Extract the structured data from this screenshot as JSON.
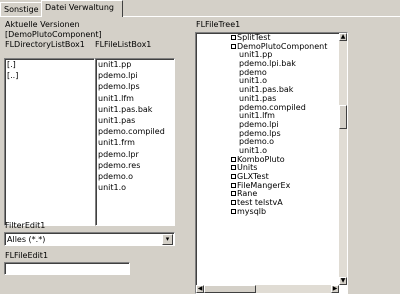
{
  "tabs": [
    "Sonstige",
    "Datei Verwaltung"
  ],
  "labels": {
    "versions": "Aktuelle Versionen",
    "component": "[DemoPlutoComponent]",
    "dir_header": "FLDirectoryListBox1",
    "file_header": "FLFileListBox1",
    "filter": "FilterEdit1",
    "file_edit": "FLFileEdit1",
    "tree": "FLFileTree1"
  },
  "dir_list": [
    "[.]",
    "[..]"
  ],
  "file_list": [
    "unit1.pp",
    "pdemo.lpi",
    "pdemo.lps",
    "unit1.lfm",
    "unit1.pas.bak",
    "unit1.pas",
    "pdemo.compiled",
    "unit1.frm",
    "pdemo.lpr",
    "pdemo.res",
    "pdemo.o",
    "unit1.o"
  ],
  "filter": {
    "value": "Alles (*.*)"
  },
  "file_edit": {
    "value": ""
  },
  "tree": [
    {
      "label": "SplitTest",
      "indent": 1,
      "box": true
    },
    {
      "label": "DemoPlutoComponent",
      "indent": 1,
      "box": true
    },
    {
      "label": "unit1.pp",
      "indent": 2,
      "box": false
    },
    {
      "label": "pdemo.lpi.bak",
      "indent": 2,
      "box": false
    },
    {
      "label": "pdemo",
      "indent": 2,
      "box": false
    },
    {
      "label": "unit1.o",
      "indent": 2,
      "box": false
    },
    {
      "label": "unit1.pas.bak",
      "indent": 2,
      "box": false
    },
    {
      "label": "unit1.pas",
      "indent": 2,
      "box": false
    },
    {
      "label": "pdemo.compiled",
      "indent": 2,
      "box": false
    },
    {
      "label": "unit1.lfm",
      "indent": 2,
      "box": false
    },
    {
      "label": "pdemo.lpi",
      "indent": 2,
      "box": false
    },
    {
      "label": "pdemo.lps",
      "indent": 2,
      "box": false
    },
    {
      "label": "pdemo.o",
      "indent": 2,
      "box": false
    },
    {
      "label": "unit1.o",
      "indent": 2,
      "box": false
    },
    {
      "label": "KomboPluto",
      "indent": 1,
      "box": true
    },
    {
      "label": "Units",
      "indent": 1,
      "box": true
    },
    {
      "label": "GLXTest",
      "indent": 1,
      "box": true
    },
    {
      "label": "FileMangerEx",
      "indent": 1,
      "box": true
    },
    {
      "label": "Rane",
      "indent": 1,
      "box": true
    },
    {
      "label": "test telstvA",
      "indent": 1,
      "box": true
    },
    {
      "label": "mysqlb",
      "indent": 1,
      "box": true
    }
  ],
  "tree_scroll": 0.3
}
